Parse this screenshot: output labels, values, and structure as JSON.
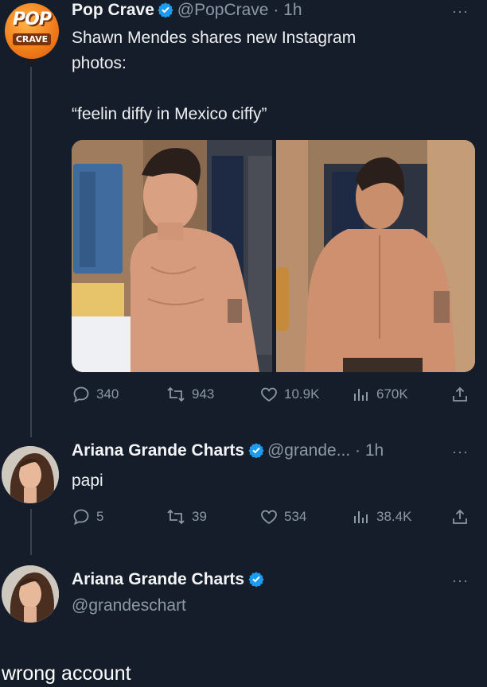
{
  "tweet1": {
    "avatar_top": "POP",
    "avatar_bottom": "CRAVE",
    "name": "Pop Crave",
    "handle_time": "@PopCrave · 1h",
    "line1": "Shawn Mendes shares new Instagram",
    "line2": "photos:",
    "quote": "“feelin diffy in Mexico ciffy”",
    "stats": {
      "replies": "340",
      "retweets": "943",
      "likes": "10.9K",
      "views": "670K"
    },
    "more": "···"
  },
  "reply": {
    "name": "Ariana Grande Charts",
    "handle_time": "@grande... · 1h",
    "text": "papi",
    "stats": {
      "replies": "5",
      "retweets": "39",
      "likes": "534",
      "views": "38.4K"
    },
    "more": "···"
  },
  "compose": {
    "name": "Ariana Grande Charts",
    "handle": "@grandeschart",
    "more": "···"
  },
  "caption": "wrong account",
  "colors": {
    "background": "#151d2a",
    "verified": "#1d9bf0",
    "muted": "#8b98a5",
    "text": "#e7e9ea"
  }
}
